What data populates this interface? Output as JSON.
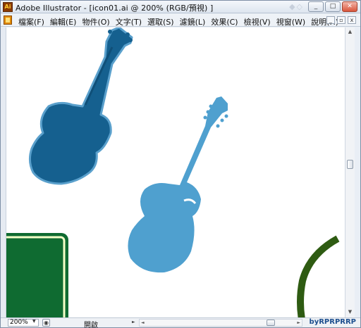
{
  "window": {
    "title": "Adobe Illustrator - [icon01.ai @ 200% (RGB/預視) ]",
    "app_icon_label": "Ai",
    "ghost_controls": "◆◇",
    "controls": [
      "_",
      "□",
      "✕"
    ]
  },
  "menu": {
    "items": [
      "檔案(F)",
      "編輯(E)",
      "物件(O)",
      "文字(T)",
      "選取(S)",
      "濾鏡(L)",
      "效果(C)",
      "檢視(V)",
      "視窗(W)",
      "說明(H)"
    ],
    "doc_controls": [
      "_",
      "▫",
      "x"
    ]
  },
  "canvas": {
    "artwork": [
      {
        "name": "dark-blue-guitar",
        "color": "#15608f",
        "outline": "#5aa0cc"
      },
      {
        "name": "light-blue-guitar",
        "color": "#4fa0cf"
      },
      {
        "name": "green-sign",
        "color": "#0f6b31",
        "border": "#f4ffc9"
      },
      {
        "name": "green-arc",
        "color": "#2e5b12"
      }
    ]
  },
  "status": {
    "zoom": "200%",
    "label": "開啟",
    "credit": "byRPRPRRP"
  },
  "scroll": {
    "up": "▲",
    "down": "▼",
    "left": "◄",
    "right": "►"
  },
  "colors": {
    "accent": "#1d4f8f",
    "close": "#d9553b"
  }
}
